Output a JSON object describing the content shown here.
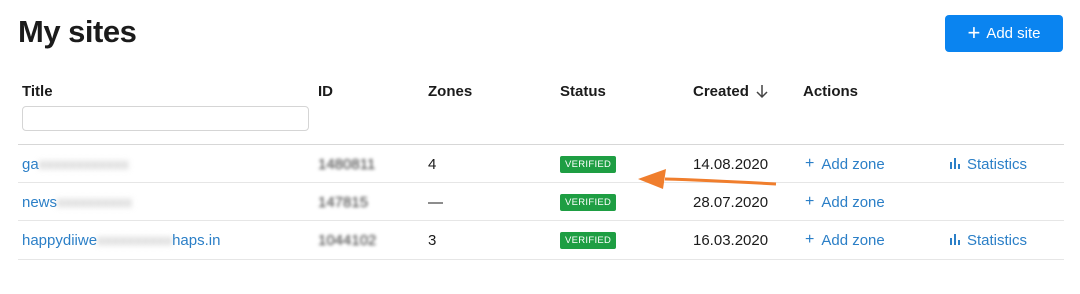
{
  "header": {
    "title": "My sites",
    "add_site_label": "Add site"
  },
  "filter": {
    "placeholder": "",
    "value": ""
  },
  "columns": {
    "title": "Title",
    "id": "ID",
    "zones": "Zones",
    "status": "Status",
    "created": "Created",
    "actions": "Actions"
  },
  "rows": [
    {
      "title_visible": "ga",
      "title_hidden": "xxxxxxxxxxxx",
      "title_suffix": "",
      "id": "1480811",
      "zones": "4",
      "status": "VERIFIED",
      "created": "14.08.2020",
      "add_zone": "Add zone",
      "statistics": "Statistics"
    },
    {
      "title_visible": "news",
      "title_hidden": "xxxxxxxxxx",
      "title_suffix": "",
      "id": "147815",
      "zones": "—",
      "status": "VERIFIED",
      "created": "28.07.2020",
      "add_zone": "Add zone",
      "statistics": ""
    },
    {
      "title_visible": "happydiiwe",
      "title_hidden": "xxxxxxxxxx",
      "title_suffix": "haps.in",
      "id": "1044102",
      "zones": "3",
      "status": "VERIFIED",
      "created": "16.03.2020",
      "add_zone": "Add zone",
      "statistics": "Statistics"
    }
  ],
  "colors": {
    "accent": "#0a84f0",
    "link": "#2b7fc7",
    "verified": "#1e9e43",
    "annotation_arrow": "#f07e2d"
  },
  "icons": {
    "add_site": "plus-icon",
    "sort": "arrow-down-icon",
    "add_zone": "plus-icon",
    "statistics": "bar-chart-icon"
  }
}
